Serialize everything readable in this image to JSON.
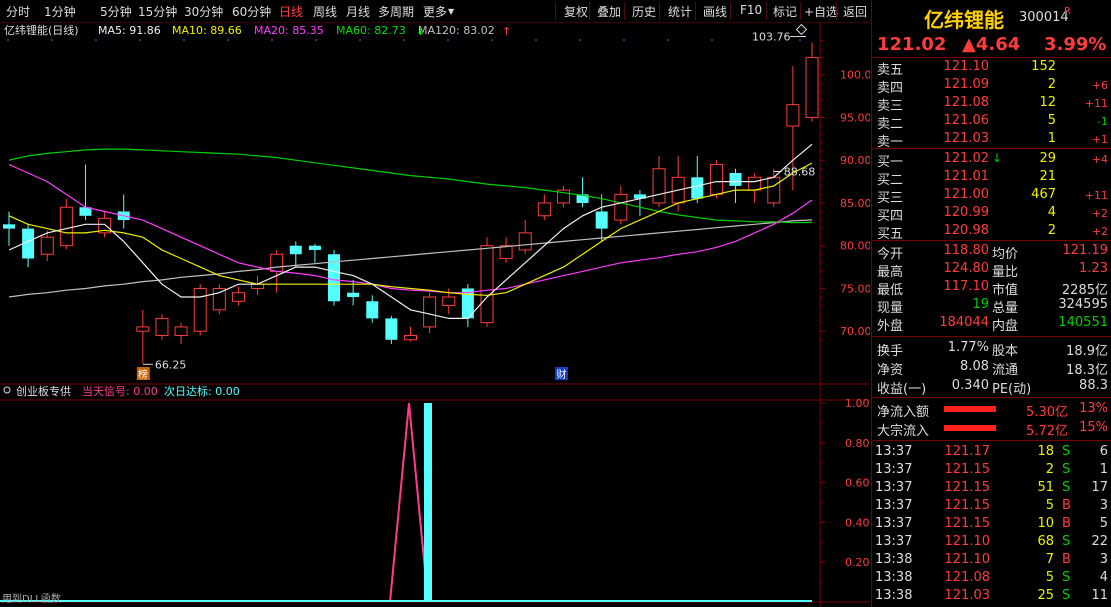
{
  "toolbar": {
    "items": [
      "分时",
      "1分钟",
      "5分钟",
      "15分钟",
      "30分钟",
      "60分钟",
      "日线",
      "周线",
      "月线",
      "多周期",
      "更多",
      "复权",
      "叠加",
      "历史",
      "统计",
      "画线",
      "F10",
      "标记",
      "+自选",
      "返回"
    ],
    "active": "日线"
  },
  "chart": {
    "title": "亿纬锂能(日线)",
    "ma_labels": [
      {
        "text": "MA5: 91.86",
        "color": "#f0f0f0"
      },
      {
        "text": "MA10: 89.66",
        "color": "#f0f000"
      },
      {
        "text": "MA20: 85.35",
        "color": "#ff3cff"
      },
      {
        "text": "MA60: 82.73",
        "color": "#00e000"
      },
      {
        "text": "MA120: 83.02",
        "color": "#c0c0c0"
      }
    ],
    "ma60_arrow": "↓",
    "ma120_arrow": "↑",
    "y_ticks": [
      "100.0",
      "95.00",
      "90.00",
      "85.00",
      "80.00",
      "75.00",
      "70.00"
    ],
    "high_label": "103.76",
    "low_label": "66.25",
    "ref_label": "88.68",
    "badge_rank": "榜",
    "badge_fin": "财",
    "candles": [
      {
        "o": 82.5,
        "c": 82.0,
        "h": 84.0,
        "l": 80.0
      },
      {
        "o": 82.0,
        "c": 78.5,
        "h": 82.5,
        "l": 77.5
      },
      {
        "o": 79.0,
        "c": 81.0,
        "h": 81.8,
        "l": 78.2
      },
      {
        "o": 80.0,
        "c": 84.5,
        "h": 85.5,
        "l": 79.6
      },
      {
        "o": 84.5,
        "c": 83.5,
        "h": 89.5,
        "l": 83.0
      },
      {
        "o": 81.5,
        "c": 83.2,
        "h": 84.0,
        "l": 81.0
      },
      {
        "o": 84.0,
        "c": 83.0,
        "h": 86.0,
        "l": 82.0
      },
      {
        "o": 70.0,
        "c": 70.5,
        "h": 72.5,
        "l": 66.25
      },
      {
        "o": 69.5,
        "c": 71.5,
        "h": 72.0,
        "l": 69.0
      },
      {
        "o": 69.5,
        "c": 70.5,
        "h": 71.0,
        "l": 68.5
      },
      {
        "o": 70.0,
        "c": 75.0,
        "h": 75.5,
        "l": 69.5
      },
      {
        "o": 72.5,
        "c": 75.0,
        "h": 75.5,
        "l": 72.0
      },
      {
        "o": 73.5,
        "c": 74.5,
        "h": 75.2,
        "l": 73.0
      },
      {
        "o": 75.0,
        "c": 75.5,
        "h": 76.5,
        "l": 74.2
      },
      {
        "o": 77.0,
        "c": 79.0,
        "h": 79.5,
        "l": 74.5
      },
      {
        "o": 80.0,
        "c": 79.0,
        "h": 80.5,
        "l": 77.5
      },
      {
        "o": 80.0,
        "c": 79.5,
        "h": 80.2,
        "l": 78.0
      },
      {
        "o": 79.0,
        "c": 73.5,
        "h": 79.5,
        "l": 73.0
      },
      {
        "o": 74.5,
        "c": 74.0,
        "h": 76.0,
        "l": 73.0
      },
      {
        "o": 73.5,
        "c": 71.5,
        "h": 74.2,
        "l": 71.0
      },
      {
        "o": 71.5,
        "c": 69.0,
        "h": 71.8,
        "l": 68.5
      },
      {
        "o": 69.0,
        "c": 69.5,
        "h": 70.5,
        "l": 68.8
      },
      {
        "o": 70.5,
        "c": 74.0,
        "h": 74.5,
        "l": 69.8
      },
      {
        "o": 73.0,
        "c": 74.0,
        "h": 75.0,
        "l": 72.0
      },
      {
        "o": 75.0,
        "c": 71.5,
        "h": 75.5,
        "l": 70.5
      },
      {
        "o": 71.0,
        "c": 80.0,
        "h": 81.0,
        "l": 70.5
      },
      {
        "o": 78.5,
        "c": 80.0,
        "h": 81.0,
        "l": 78.0
      },
      {
        "o": 79.5,
        "c": 81.5,
        "h": 83.0,
        "l": 79.0
      },
      {
        "o": 83.5,
        "c": 85.0,
        "h": 86.0,
        "l": 83.0
      },
      {
        "o": 85.0,
        "c": 86.5,
        "h": 87.0,
        "l": 84.5
      },
      {
        "o": 86.0,
        "c": 85.0,
        "h": 88.0,
        "l": 84.5
      },
      {
        "o": 84.0,
        "c": 82.0,
        "h": 86.0,
        "l": 80.5
      },
      {
        "o": 83.0,
        "c": 86.0,
        "h": 87.0,
        "l": 82.5
      },
      {
        "o": 86.0,
        "c": 85.5,
        "h": 86.5,
        "l": 83.5
      },
      {
        "o": 85.0,
        "c": 89.0,
        "h": 90.5,
        "l": 84.5
      },
      {
        "o": 85.0,
        "c": 88.0,
        "h": 90.5,
        "l": 84.0
      },
      {
        "o": 88.0,
        "c": 85.5,
        "h": 90.5,
        "l": 85.0
      },
      {
        "o": 86.0,
        "c": 89.5,
        "h": 90.0,
        "l": 85.5
      },
      {
        "o": 88.5,
        "c": 87.0,
        "h": 89.0,
        "l": 85.0
      },
      {
        "o": 86.5,
        "c": 88.0,
        "h": 88.5,
        "l": 85.0
      },
      {
        "o": 85.0,
        "c": 88.0,
        "h": 89.0,
        "l": 84.5
      },
      {
        "o": 94.0,
        "c": 96.5,
        "h": 101.0,
        "l": 86.5
      },
      {
        "o": 95.0,
        "c": 102.0,
        "h": 103.76,
        "l": 94.5
      }
    ],
    "ma5": [
      79.5,
      80.5,
      81.5,
      82.0,
      82.5,
      82.5,
      80.5,
      78.0,
      75.5,
      74.0,
      74.0,
      74.5,
      75.5,
      75.5,
      76.5,
      77.5,
      77.5,
      77.0,
      76.5,
      75.5,
      74.0,
      72.5,
      72.0,
      71.5,
      71.5,
      74.0,
      76.0,
      78.0,
      80.0,
      82.0,
      83.5,
      84.5,
      85.0,
      85.5,
      86.0,
      86.5,
      87.0,
      87.5,
      87.5,
      87.5,
      88.0,
      90.0,
      91.86
    ],
    "ma10": [
      83.5,
      82.5,
      82.0,
      81.5,
      81.5,
      81.8,
      81.5,
      81.0,
      79.5,
      78.5,
      77.5,
      76.5,
      76.0,
      75.5,
      75.5,
      75.5,
      75.5,
      75.5,
      75.5,
      75.5,
      75.2,
      75.0,
      74.8,
      74.5,
      74.3,
      74.2,
      74.5,
      75.5,
      76.5,
      77.5,
      79.0,
      80.5,
      82.0,
      83.0,
      84.0,
      85.0,
      85.5,
      86.0,
      86.5,
      86.5,
      87.0,
      88.5,
      89.66
    ],
    "ma20": [
      89.5,
      88.5,
      87.5,
      86.0,
      84.5,
      84.0,
      83.5,
      83.0,
      82.0,
      81.0,
      80.0,
      79.0,
      78.0,
      77.5,
      77.0,
      76.8,
      76.5,
      76.0,
      75.8,
      75.5,
      75.0,
      74.8,
      74.7,
      74.5,
      74.5,
      74.8,
      75.0,
      75.5,
      76.0,
      76.5,
      77.0,
      77.5,
      78.0,
      78.3,
      78.6,
      79.0,
      79.3,
      79.8,
      80.5,
      81.5,
      82.5,
      83.8,
      85.35
    ],
    "ma60": [
      90.0,
      90.5,
      90.8,
      91.0,
      91.2,
      91.3,
      91.3,
      91.2,
      91.1,
      91.0,
      90.9,
      90.8,
      90.7,
      90.5,
      90.3,
      90.0,
      89.7,
      89.4,
      89.1,
      88.8,
      88.5,
      88.2,
      88.0,
      87.8,
      87.5,
      87.2,
      87.0,
      86.8,
      86.5,
      86.2,
      85.9,
      85.5,
      85.0,
      84.5,
      84.0,
      83.6,
      83.3,
      83.0,
      82.9,
      82.8,
      82.8,
      82.7,
      82.73
    ],
    "ma120": [
      74.0,
      74.3,
      74.5,
      74.8,
      75.0,
      75.3,
      75.5,
      75.8,
      76.0,
      76.3,
      76.5,
      76.7,
      77.0,
      77.2,
      77.5,
      77.7,
      77.9,
      78.1,
      78.3,
      78.5,
      78.7,
      78.9,
      79.1,
      79.3,
      79.5,
      79.7,
      79.9,
      80.1,
      80.3,
      80.5,
      80.7,
      80.9,
      81.1,
      81.3,
      81.5,
      81.7,
      81.9,
      82.1,
      82.3,
      82.5,
      82.7,
      82.9,
      83.02
    ],
    "sub": {
      "title": "创业板专供",
      "signal_label": "当天信号: 0.00",
      "next_label": "次日达标: 0.00",
      "y_ticks": [
        "1.00",
        "0.80",
        "0.60",
        "0.40",
        "0.20"
      ],
      "footer": "用到DLL函数"
    }
  },
  "panel": {
    "name": "亿纬锂能",
    "code": "300014",
    "r_mark": "R",
    "price": "121.02",
    "change": "▲4.64",
    "pct": "3.99%",
    "asks": [
      {
        "label": "卖五",
        "price": "121.10",
        "vol": "152",
        "chg": ""
      },
      {
        "label": "卖四",
        "price": "121.09",
        "vol": "2",
        "chg": "+6"
      },
      {
        "label": "卖三",
        "price": "121.08",
        "vol": "12",
        "chg": "+11"
      },
      {
        "label": "卖二",
        "price": "121.06",
        "vol": "5",
        "chg": "-1"
      },
      {
        "label": "卖一",
        "price": "121.03",
        "vol": "1",
        "chg": "+1"
      }
    ],
    "bids": [
      {
        "label": "买一",
        "price": "121.02",
        "vol": "29",
        "chg": "+4"
      },
      {
        "label": "买二",
        "price": "121.01",
        "vol": "21",
        "chg": ""
      },
      {
        "label": "买三",
        "price": "121.00",
        "vol": "467",
        "chg": "+11"
      },
      {
        "label": "买四",
        "price": "120.99",
        "vol": "4",
        "chg": "+2"
      },
      {
        "label": "买五",
        "price": "120.98",
        "vol": "2",
        "chg": "+2"
      }
    ],
    "stats": [
      {
        "l1": "今开",
        "v1": "118.80",
        "c1": "red",
        "l2": "均价",
        "v2": "121.19",
        "c2": "red"
      },
      {
        "l1": "最高",
        "v1": "124.80",
        "c1": "red",
        "l2": "量比",
        "v2": "1.23",
        "c2": "red"
      },
      {
        "l1": "最低",
        "v1": "117.10",
        "c1": "red",
        "l2": "市值",
        "v2": "2285亿",
        "c2": "white"
      },
      {
        "l1": "现量",
        "v1": "19",
        "c1": "green",
        "l2": "总量",
        "v2": "324595",
        "c2": "white"
      },
      {
        "l1": "外盘",
        "v1": "184044",
        "c1": "red",
        "l2": "内盘",
        "v2": "140551",
        "c2": "green"
      }
    ],
    "stats2": [
      {
        "l1": "换手",
        "v1": "1.77%",
        "l2": "股本",
        "v2": "18.9亿"
      },
      {
        "l1": "净资",
        "v1": "8.08",
        "l2": "流通",
        "v2": "18.3亿"
      },
      {
        "l1": "收益(一)",
        "v1": "0.340",
        "l2": "PE(动)",
        "v2": "88.3"
      }
    ],
    "flows": [
      {
        "label": "净流入额",
        "value": "5.30亿",
        "pct": "13%"
      },
      {
        "label": "大宗流入",
        "value": "5.72亿",
        "pct": "15%"
      }
    ],
    "ticks": [
      {
        "time": "13:37",
        "price": "121.17",
        "vol": "18",
        "bs": "S",
        "n": "6"
      },
      {
        "time": "13:37",
        "price": "121.15",
        "vol": "2",
        "bs": "S",
        "n": "1"
      },
      {
        "time": "13:37",
        "price": "121.15",
        "vol": "51",
        "bs": "S",
        "n": "17"
      },
      {
        "time": "13:37",
        "price": "121.15",
        "vol": "5",
        "bs": "B",
        "n": "3"
      },
      {
        "time": "13:37",
        "price": "121.15",
        "vol": "10",
        "bs": "B",
        "n": "5"
      },
      {
        "time": "13:37",
        "price": "121.10",
        "vol": "68",
        "bs": "S",
        "n": "22"
      },
      {
        "time": "13:38",
        "price": "121.10",
        "vol": "7",
        "bs": "B",
        "n": "3"
      },
      {
        "time": "13:38",
        "price": "121.08",
        "vol": "5",
        "bs": "S",
        "n": "4"
      },
      {
        "time": "13:38",
        "price": "121.03",
        "vol": "25",
        "bs": "S",
        "n": "11"
      }
    ]
  },
  "colors": {
    "up": "#ff3c3c",
    "down": "#54ffff",
    "bg": "#000000",
    "grid": "#7a0000"
  }
}
